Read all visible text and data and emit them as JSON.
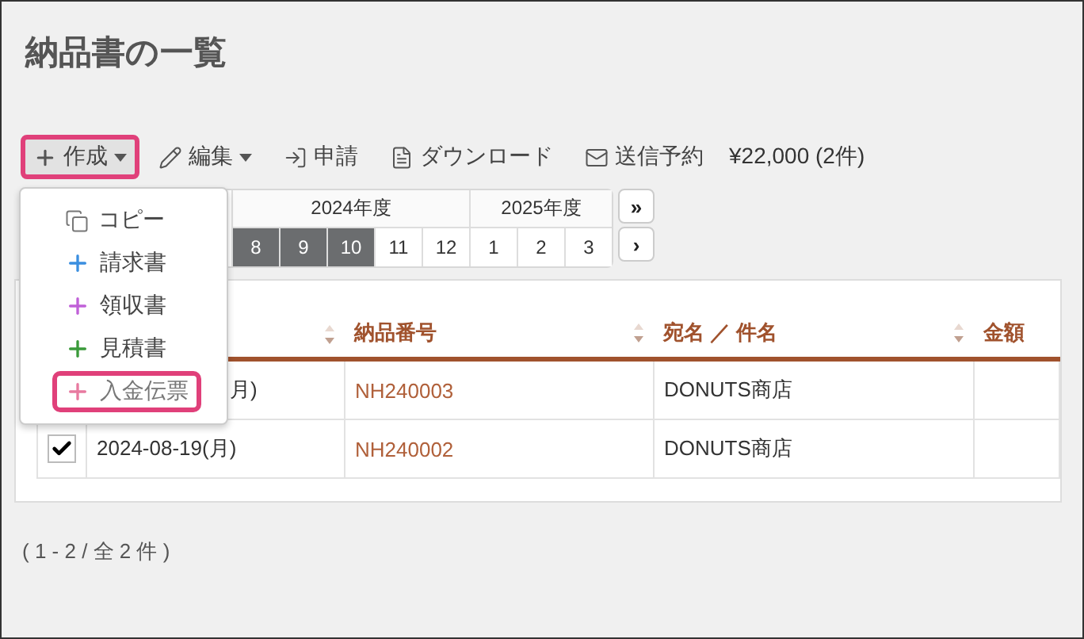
{
  "title": "納品書の一覧",
  "toolbar": [
    {
      "label": "作成",
      "kind": "create",
      "dropdown": true,
      "highlighted": true
    },
    {
      "label": "編集",
      "kind": "edit",
      "dropdown": true,
      "highlighted": false
    },
    {
      "label": "申請",
      "kind": "apply",
      "dropdown": false,
      "highlighted": false
    },
    {
      "label": "ダウンロード",
      "kind": "download",
      "dropdown": false,
      "highlighted": false
    },
    {
      "label": "送信予約",
      "kind": "schedule",
      "dropdown": false,
      "highlighted": false
    }
  ],
  "total": "¥22,000 (2件)",
  "menu": {
    "open": true,
    "items": [
      {
        "label": "コピー",
        "kind": "copy",
        "color": "#777777",
        "highlighted": false
      },
      {
        "label": "請求書",
        "kind": "new",
        "color": "#3b8fe0",
        "highlighted": false
      },
      {
        "label": "領収書",
        "kind": "new",
        "color": "#c060d8",
        "highlighted": false
      },
      {
        "label": "見積書",
        "kind": "new",
        "color": "#3a9a3a",
        "highlighted": false
      },
      {
        "label": "入金伝票",
        "kind": "new",
        "color": "#e87aa0",
        "highlighted": true
      }
    ]
  },
  "months": {
    "years": [
      {
        "label": "2024年度",
        "items": [
          {
            "label": "8",
            "selected": true
          },
          {
            "label": "9",
            "selected": true
          },
          {
            "label": "10",
            "selected": true
          },
          {
            "label": "11",
            "selected": false
          },
          {
            "label": "12",
            "selected": false
          }
        ]
      },
      {
        "label": "2025年度",
        "items": [
          {
            "label": "1",
            "selected": false
          },
          {
            "label": "2",
            "selected": false
          },
          {
            "label": "3",
            "selected": false
          }
        ]
      }
    ],
    "next_year": "»",
    "next_month": "›"
  },
  "table": {
    "columns": [
      "納品番号",
      "宛名 ／ 件名",
      "金額"
    ],
    "rows": [
      {
        "date": "月)",
        "number": "NH240003",
        "name": "DONUTS商店"
      },
      {
        "checked": true,
        "date": "2024-08-19(月)",
        "number": "NH240002",
        "name": "DONUTS商店"
      }
    ]
  },
  "pagination": "( 1 - 2 / 全 2 件 )"
}
